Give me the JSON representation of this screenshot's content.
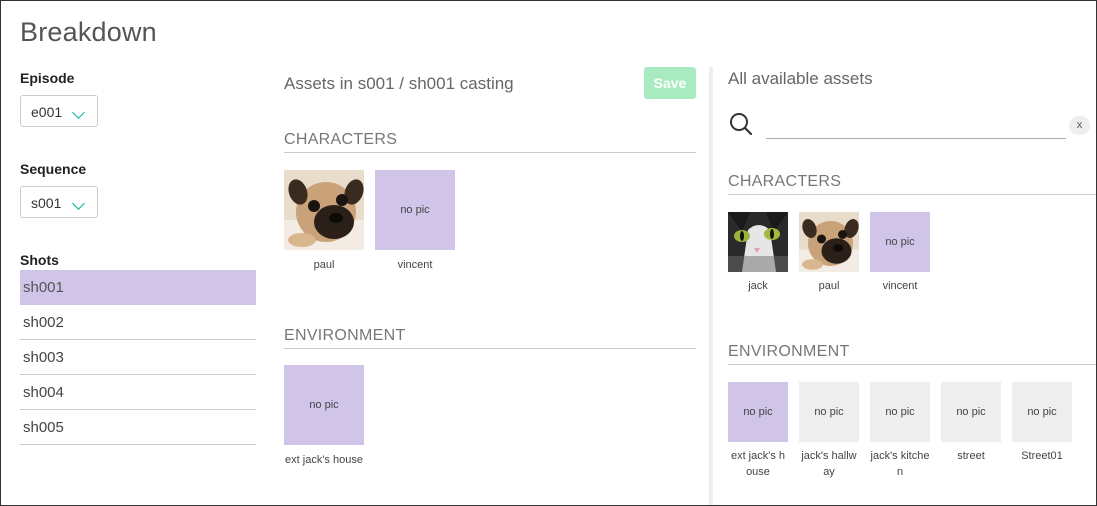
{
  "page": {
    "title": "Breakdown"
  },
  "episode": {
    "label": "Episode",
    "value": "e001"
  },
  "sequence": {
    "label": "Sequence",
    "value": "s001"
  },
  "shots": {
    "label": "Shots",
    "items": [
      {
        "label": "sh001",
        "selected": true
      },
      {
        "label": "sh002",
        "selected": false
      },
      {
        "label": "sh003",
        "selected": false
      },
      {
        "label": "sh004",
        "selected": false
      },
      {
        "label": "sh005",
        "selected": false
      }
    ]
  },
  "casting": {
    "title": "Assets in s001 / sh001 casting",
    "save_label": "Save",
    "characters_title": "CHARACTERS",
    "characters": [
      {
        "name": "paul",
        "picture": "pug-photo"
      },
      {
        "name": "vincent",
        "picture": "no pic"
      }
    ],
    "environment_title": "ENVIRONMENT",
    "environment": [
      {
        "name": "ext jack's house",
        "picture": "no pic"
      }
    ]
  },
  "available": {
    "title": "All available assets",
    "search": {
      "value": "",
      "placeholder": ""
    },
    "clear_label": "x",
    "characters_title": "CHARACTERS",
    "characters": [
      {
        "name": "jack",
        "picture": "cat-photo"
      },
      {
        "name": "paul",
        "picture": "pug-photo"
      },
      {
        "name": "vincent",
        "picture": "no pic"
      }
    ],
    "environment_title": "ENVIRONMENT",
    "environment": [
      {
        "name": "ext jack's house",
        "picture": "no pic",
        "selected": true
      },
      {
        "name": "jack's hallway",
        "picture": "no pic",
        "selected": false
      },
      {
        "name": "jack's kitchen",
        "picture": "no pic",
        "selected": false
      },
      {
        "name": "street",
        "picture": "no pic",
        "selected": false
      },
      {
        "name": "Street01",
        "picture": "no pic",
        "selected": false
      }
    ]
  },
  "colors": {
    "selected": "#d1c4e9",
    "accent": "#00b59a",
    "save_button": "#a8ebc0",
    "unselected_thumb": "#eeeeee"
  },
  "icons": {
    "search": "search-icon",
    "dropdown": "chevron-down-icon"
  }
}
